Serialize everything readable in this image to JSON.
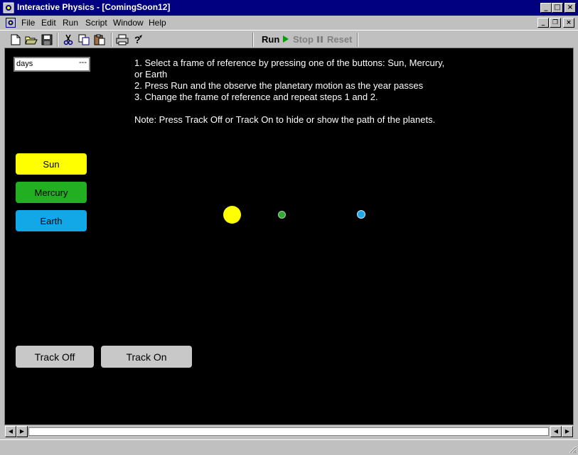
{
  "window": {
    "title": "Interactive Physics - [ComingSoon12]",
    "controls": {
      "minimize": "_",
      "maximize": "□",
      "close": "×"
    }
  },
  "menubar": {
    "items": [
      {
        "label": "File"
      },
      {
        "label": "Edit"
      },
      {
        "label": "Run"
      },
      {
        "label": "Script"
      },
      {
        "label": "Window"
      },
      {
        "label": "Help"
      }
    ],
    "mdi_controls": {
      "minimize": "_",
      "restore": "❐",
      "close": "×"
    }
  },
  "toolbar": {
    "icons": [
      "new-file-icon",
      "open-folder-icon",
      "save-icon",
      "cut-icon",
      "copy-icon",
      "paste-icon",
      "print-icon",
      "help-icon"
    ],
    "run_label": "Run",
    "stop_label": "Stop",
    "reset_label": "Reset"
  },
  "workspace": {
    "units_field": {
      "value": "days",
      "menu": "---"
    },
    "instructions": {
      "line1": "1. Select a frame of reference by pressing one of the buttons: Sun, Mercury,",
      "line2": "or Earth",
      "line3": "2. Press Run and the observe the planetary motion as the year passes",
      "line4": "3. Change the frame of reference and repeat steps 1 and 2.",
      "note": "Note: Press Track Off or Track On to hide or show the path of the planets."
    },
    "frame_buttons": [
      {
        "label": "Sun",
        "color": "#ffff00"
      },
      {
        "label": "Mercury",
        "color": "#22b022"
      },
      {
        "label": "Earth",
        "color": "#12a8e8"
      }
    ],
    "track_buttons": {
      "off_label": "Track Off",
      "on_label": "Track On",
      "color": "#c8c8c8"
    },
    "bodies": [
      {
        "name": "sun",
        "color": "#ffff00"
      },
      {
        "name": "mercury",
        "color": "#33aa33"
      },
      {
        "name": "earth",
        "color": "#22a8e8"
      }
    ],
    "background": "#000000"
  }
}
